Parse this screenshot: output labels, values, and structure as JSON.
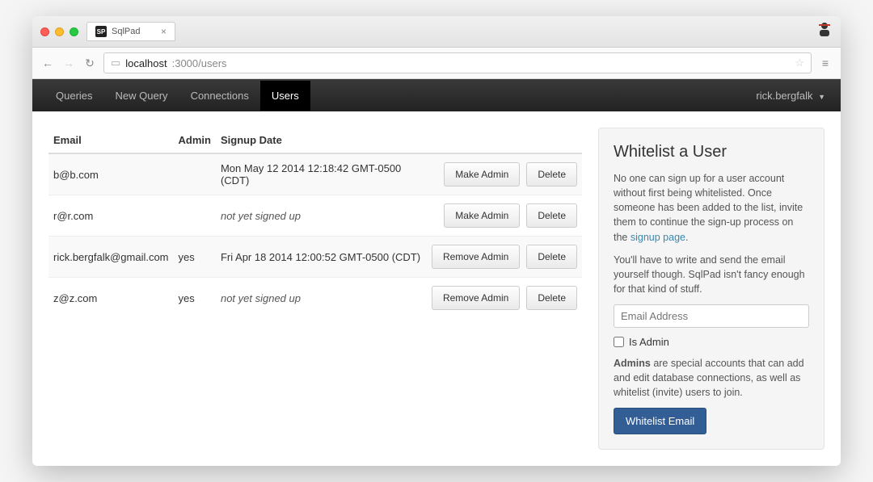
{
  "browser": {
    "tab_title": "SqlPad",
    "tab_favicon_text": "SP",
    "url_host": "localhost",
    "url_port_path": ":3000/users"
  },
  "navbar": {
    "items": [
      {
        "label": "Queries",
        "active": false
      },
      {
        "label": "New Query",
        "active": false
      },
      {
        "label": "Connections",
        "active": false
      },
      {
        "label": "Users",
        "active": true
      }
    ],
    "current_user": "rick.bergfalk"
  },
  "users_table": {
    "headers": {
      "email": "Email",
      "admin": "Admin",
      "signup": "Signup Date"
    },
    "not_signed_label": "not yet signed up",
    "rows": [
      {
        "email": "b@b.com",
        "admin": "",
        "signup": "Mon May 12 2014 12:18:42 GMT-0500 (CDT)",
        "signed_up": true,
        "admin_action": "Make Admin",
        "delete_label": "Delete"
      },
      {
        "email": "r@r.com",
        "admin": "",
        "signup": "not yet signed up",
        "signed_up": false,
        "admin_action": "Make Admin",
        "delete_label": "Delete"
      },
      {
        "email": "rick.bergfalk@gmail.com",
        "admin": "yes",
        "signup": "Fri Apr 18 2014 12:00:52 GMT-0500 (CDT)",
        "signed_up": true,
        "admin_action": "Remove Admin",
        "delete_label": "Delete"
      },
      {
        "email": "z@z.com",
        "admin": "yes",
        "signup": "not yet signed up",
        "signed_up": false,
        "admin_action": "Remove Admin",
        "delete_label": "Delete"
      }
    ]
  },
  "whitelist_panel": {
    "title": "Whitelist a User",
    "p1_before": "No one can sign up for a user account without first being whitelisted. Once someone has been added to the list, invite them to continue the sign-up process on the ",
    "p1_link": "signup page",
    "p1_after": ".",
    "p2": "You'll have to write and send the email yourself though. SqlPad isn't fancy enough for that kind of stuff.",
    "email_placeholder": "Email Address",
    "is_admin_label": "Is Admin",
    "p3_strong": "Admins",
    "p3_rest": " are special accounts that can add and edit database connections, as well as whitelist (invite) users to join.",
    "submit_label": "Whitelist Email"
  }
}
